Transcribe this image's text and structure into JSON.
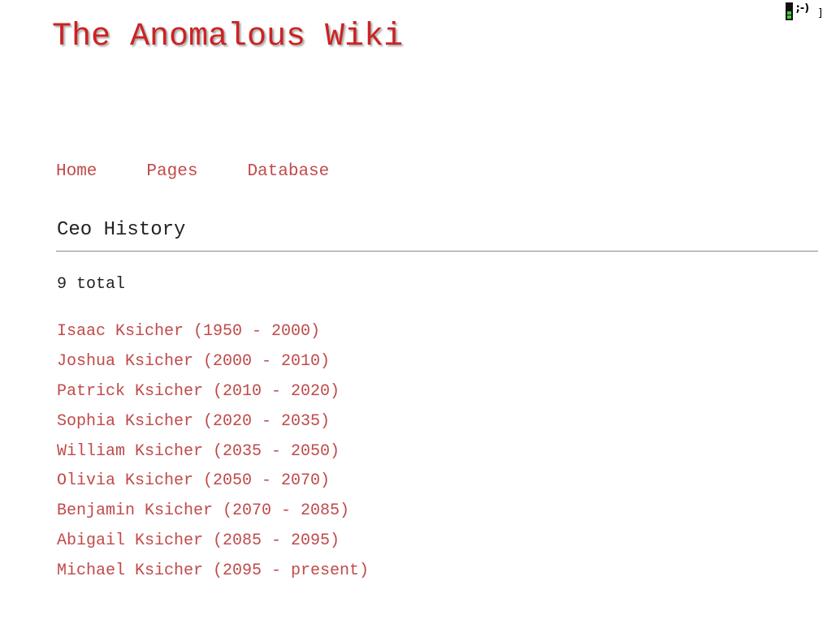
{
  "site": {
    "title": "The Anomalous Wiki",
    "title_color": "#cc2222"
  },
  "status": {
    "icon": "battery-icon",
    "emote": ";-)",
    "trailing": "]"
  },
  "nav": {
    "items": [
      {
        "label": "Home"
      },
      {
        "label": "Pages"
      },
      {
        "label": "Database"
      }
    ],
    "link_color": "#c04a4a"
  },
  "page": {
    "heading": "Ceo History",
    "count_text": "9 total"
  },
  "ceos": [
    {
      "label": "Isaac Ksicher (1950 - 2000)"
    },
    {
      "label": "Joshua Ksicher (2000 - 2010)"
    },
    {
      "label": "Patrick Ksicher (2010 - 2020)"
    },
    {
      "label": "Sophia Ksicher (2020 - 2035)"
    },
    {
      "label": "William Ksicher (2035 - 2050)"
    },
    {
      "label": "Olivia Ksicher (2050 - 2070)"
    },
    {
      "label": "Benjamin Ksicher (2070 - 2085)"
    },
    {
      "label": "Abigail Ksicher (2085 - 2095)"
    },
    {
      "label": "Michael Ksicher (2095 - present)"
    }
  ]
}
